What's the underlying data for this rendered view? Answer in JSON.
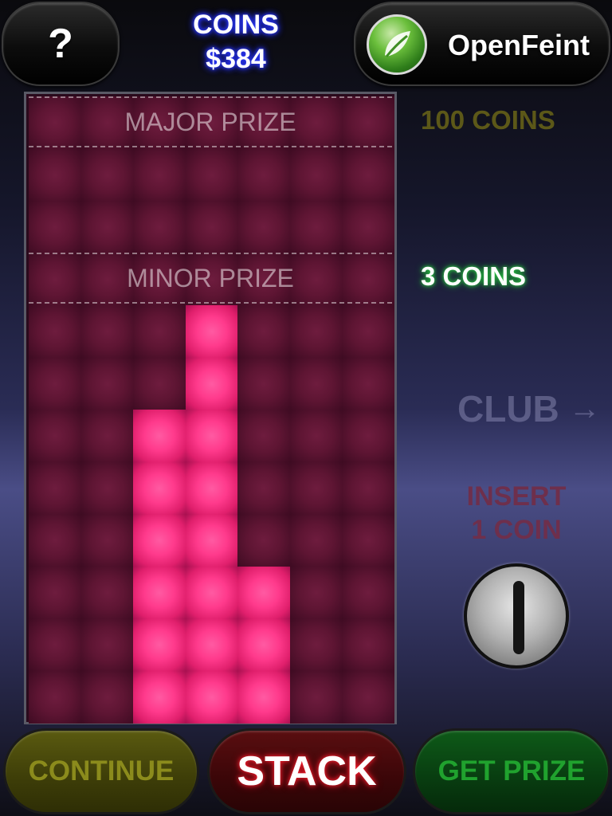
{
  "header": {
    "help_label": "?",
    "coins_label": "COINS",
    "coins_value": "$384",
    "openfeint_label": "OpenFeint",
    "openfeint_icon": "openfeint-leaf-icon"
  },
  "board": {
    "columns": 7,
    "rows": 12,
    "zones": {
      "major_label": "MAJOR PRIZE",
      "minor_label": "MINOR PRIZE"
    },
    "column_heights": [
      0,
      0,
      6,
      8,
      3,
      0,
      0
    ]
  },
  "prizes": {
    "major_coins": "100 COINS",
    "minor_coins": "3 COINS"
  },
  "club": {
    "label": "CLUB",
    "arrow": "→"
  },
  "insert": {
    "line1": "INSERT",
    "line2": "1 COIN"
  },
  "buttons": {
    "continue": "CONTINUE",
    "stack": "STACK",
    "get_prize": "GET PRIZE"
  },
  "colors": {
    "lit_cell": "#ff3a8c",
    "unlit_cell": "#5e1533",
    "coins_glow": "#2b37ff",
    "minor_glow": "#2bd443"
  }
}
